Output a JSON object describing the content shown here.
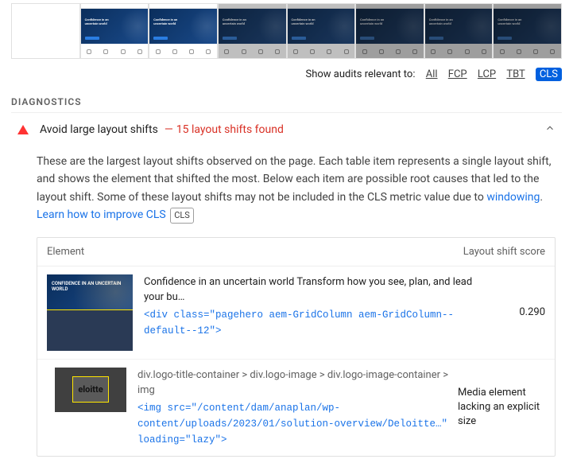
{
  "relevance": {
    "label": "Show audits relevant to:",
    "filters": [
      "All",
      "FCP",
      "LCP",
      "TBT",
      "CLS"
    ],
    "active": "CLS"
  },
  "section": {
    "diagnostics": "DIAGNOSTICS"
  },
  "audit": {
    "title": "Avoid large layout shifts",
    "detail_dash": "—",
    "detail_text": "15 layout shifts found",
    "description_1": "These are the largest layout shifts observed on the page. Each table item represents a single layout shift, and shows the element that shifted the most. Below each item are possible root causes that led to the layout shift. Some of these layout shifts may not be included in the CLS metric value due to ",
    "link_windowing": "windowing",
    "period": ". ",
    "link_learn": "Learn how to improve CLS",
    "badge": "CLS"
  },
  "table": {
    "col_element": "Element",
    "col_score": "Layout shift score",
    "rows": [
      {
        "text": "Confidence in an uncertain world Transform how you see, plan, and lead your bu…",
        "code": "<div class=\"pagehero aem-GridColumn aem-GridColumn--default--12\">",
        "score": "0.290",
        "thumb_caption": "CONFIDENCE IN AN\nUNCERTAIN WORLD"
      },
      {
        "path": "div.logo-title-container > div.logo-image > div.logo-image-container > img",
        "code": "<img src=\"/content/dam/anaplan/wp-content/uploads/2023/01/solution-overview/Deloitte…\" loading=\"lazy\">",
        "note": "Media element lacking an explicit size",
        "logo_text": "eloitte"
      }
    ]
  }
}
